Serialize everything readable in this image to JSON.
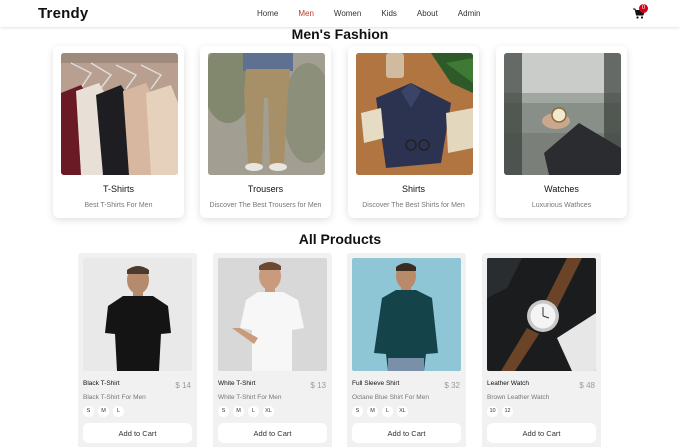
{
  "brand": "Trendy",
  "nav": [
    "Home",
    "Men",
    "Women",
    "Kids",
    "About",
    "Admin"
  ],
  "active_nav": "Men",
  "cart": {
    "count": "0",
    "icon": "shopping-cart-icon"
  },
  "colors": {
    "accent": "#c0392b",
    "badge": "#d0021b"
  },
  "categories_title": "Men's Fashion",
  "categories": [
    {
      "name": "T-Shirts",
      "desc": "Best T-Shirts For Men"
    },
    {
      "name": "Trousers",
      "desc": "Discover The Best Trousers for Men"
    },
    {
      "name": "Shirts",
      "desc": "Discover The Best Shirts for Men"
    },
    {
      "name": "Watches",
      "desc": "Luxurious Wathces"
    }
  ],
  "products_title": "All Products",
  "products": [
    {
      "name": "Black T-Shirt",
      "price": "$ 14",
      "desc": "Black T-Shirt For Men",
      "sizes": [
        "S",
        "M",
        "L"
      ],
      "button": "Add to Cart"
    },
    {
      "name": "White T-Shirt",
      "price": "$ 13",
      "desc": "White T-Shirt For Men",
      "sizes": [
        "S",
        "M",
        "L",
        "XL"
      ],
      "button": "Add to Cart"
    },
    {
      "name": "Full Sleeve Shirt",
      "price": "$ 32",
      "desc": "Octane Blue Shirt For Men",
      "sizes": [
        "S",
        "M",
        "L",
        "XL"
      ],
      "button": "Add to Cart"
    },
    {
      "name": "Leather Watch",
      "price": "$ 48",
      "desc": "Brown Leather Watch",
      "sizes": [
        "10",
        "12"
      ],
      "button": "Add to Cart"
    }
  ]
}
